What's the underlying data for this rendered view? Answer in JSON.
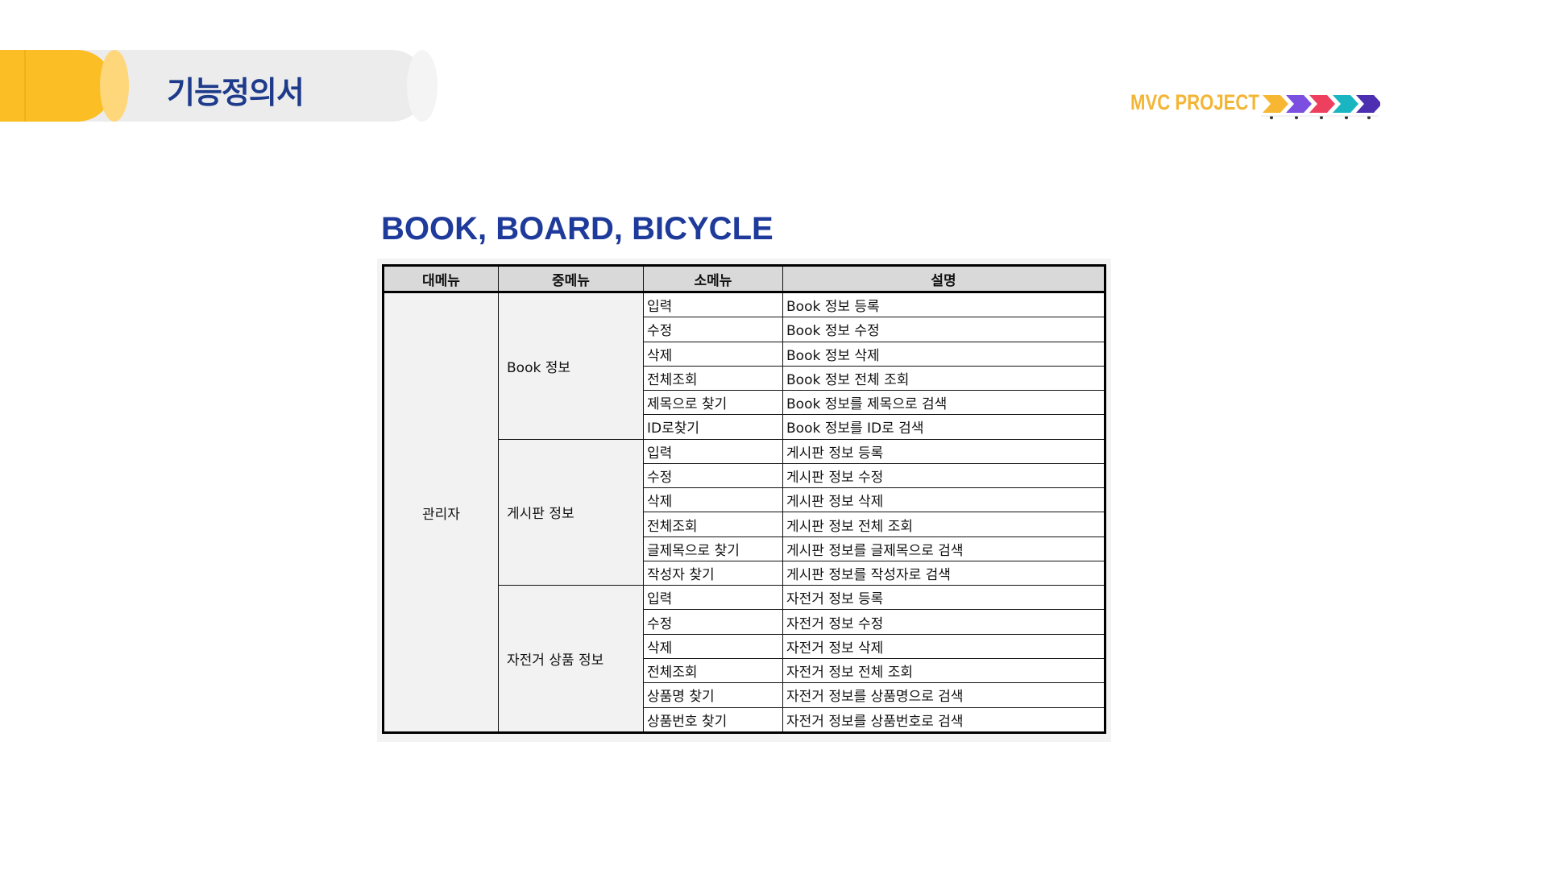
{
  "banner": {
    "title": "기능정의서",
    "accent_color": "#fbbf25",
    "title_color": "#1e3a8a"
  },
  "project_tag": {
    "label": "MVC PROJECT",
    "icon": "arrow-chevrons-icon",
    "arrow_colors": [
      "#f7b733",
      "#7b4fe0",
      "#ef3f5e",
      "#19b6c2",
      "#4b2fb0"
    ]
  },
  "section": {
    "title": "BOOK, BOARD, BICYCLE"
  },
  "table": {
    "headers": [
      "대메뉴",
      "중메뉴",
      "소메뉴",
      "설명"
    ],
    "main_menu": "관리자",
    "groups": [
      {
        "name": "Book 정보",
        "rows": [
          {
            "sub": "입력",
            "desc": "Book 정보 등록"
          },
          {
            "sub": "수정",
            "desc": "Book 정보 수정"
          },
          {
            "sub": "삭제",
            "desc": "Book 정보 삭제"
          },
          {
            "sub": "전체조회",
            "desc": "Book 정보 전체 조회"
          },
          {
            "sub": "제목으로 찾기",
            "desc": "Book 정보를 제목으로 검색"
          },
          {
            "sub": "ID로찾기",
            "desc": "Book 정보를 ID로 검색"
          }
        ]
      },
      {
        "name": "게시판 정보",
        "rows": [
          {
            "sub": "입력",
            "desc": "게시판 정보 등록"
          },
          {
            "sub": "수정",
            "desc": "게시판 정보 수정"
          },
          {
            "sub": "삭제",
            "desc": "게시판 정보 삭제"
          },
          {
            "sub": "전체조회",
            "desc": "게시판 정보 전체 조회"
          },
          {
            "sub": "글제목으로 찾기",
            "desc": "게시판 정보를 글제목으로 검색"
          },
          {
            "sub": "작성자 찾기",
            "desc": "게시판 정보를 작성자로 검색"
          }
        ]
      },
      {
        "name": "자전거 상품 정보",
        "rows": [
          {
            "sub": "입력",
            "desc": "자전거  정보 등록"
          },
          {
            "sub": "수정",
            "desc": "자전거  정보 수정"
          },
          {
            "sub": "삭제",
            "desc": "자전거  정보 삭제"
          },
          {
            "sub": "전체조회",
            "desc": "자전거  정보 전체 조회"
          },
          {
            "sub": "상품명 찾기",
            "desc": "자전거  정보를 상품명으로 검색"
          },
          {
            "sub": "상품번호 찾기",
            "desc": "자전거 정보를 상품번호로 검색"
          }
        ]
      }
    ]
  }
}
